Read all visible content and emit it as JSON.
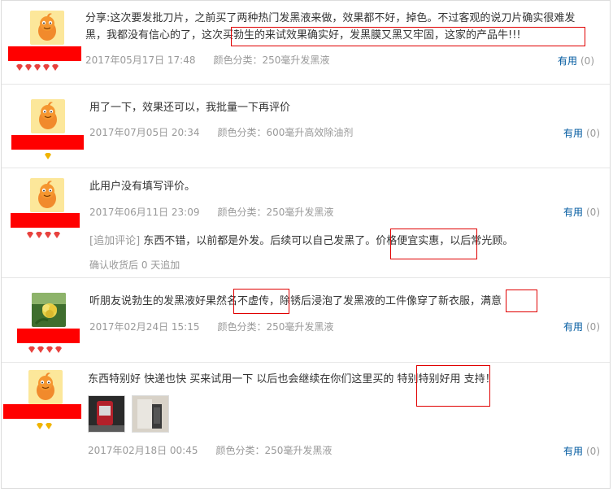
{
  "reviews": [
    {
      "text": "分享:这次要发批刀片，之前买了两种热门发黑液来做，效果都不好，掉色。不过客观的说刀片确实很难发黑，我都没有信心的了，这次买勃生的来试效果确实好，发黑膜又黑又牢固，这家的产品牛!!!",
      "date": "2017年05月17日 17:48",
      "sku": "颜色分类：250毫升发黑液",
      "useful_label": "有用",
      "useful_count": "(0)",
      "avatar": "mascot-avatar",
      "rank_icons": "diamond-icon x5"
    },
    {
      "text": "用了一下，效果还可以，我批量一下再评价",
      "date": "2017年07月05日 20:34",
      "sku": "颜色分类：600毫升高效除油剂",
      "useful_label": "有用",
      "useful_count": "(0)",
      "avatar": "mascot-avatar",
      "rank_icons": "gold-diamond-icon x1"
    },
    {
      "text": "此用户没有填写评价。",
      "date": "2017年06月11日 23:09",
      "sku": "颜色分类：250毫升发黑液",
      "useful_label": "有用",
      "useful_count": "(0)",
      "append_tag": "[追加评论]",
      "append_text": "东西不错，以前都是外发。后续可以自己发黑了。价格便宜实惠，以后常光顾。",
      "append_note": "确认收货后 0 天追加",
      "avatar": "mascot-avatar",
      "rank_icons": "diamond-icon x4"
    },
    {
      "text": "听朋友说勃生的发黑液好果然名不虚传，除锈后浸泡了发黑液的工件像穿了新衣服，满意",
      "date": "2017年02月24日 15:15",
      "sku": "颜色分类：250毫升发黑液",
      "useful_label": "有用",
      "useful_count": "(0)",
      "avatar": "flower-avatar",
      "rank_icons": "diamond-icon x4"
    },
    {
      "text": "东西特别好 快递也快 买来试用一下 以后也会继续在你们这里买的 特别特别好用 支持！",
      "date": "2017年02月18日 00:45",
      "sku": "颜色分类：250毫升发黑液",
      "useful_label": "有用",
      "useful_count": "(0)",
      "avatar": "mascot-avatar",
      "rank_icons": "gold-diamond-icon x2",
      "photos": [
        "photo-thumbnail-1",
        "photo-thumbnail-2"
      ]
    }
  ],
  "colors": {
    "link": "#005aa0",
    "meta": "#999999",
    "redaction": "#ff0000",
    "highlight_box": "#e00000",
    "divider": "#e6e6e6"
  }
}
